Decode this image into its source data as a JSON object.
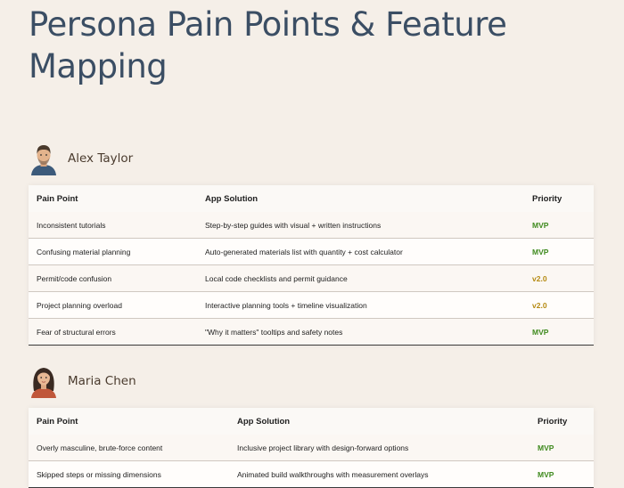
{
  "page": {
    "title": "Persona Pain Points & Feature Mapping"
  },
  "colors": {
    "mvp": "#3f8a1e",
    "v2": "#b58a12"
  },
  "table_headers": {
    "pain_point": "Pain Point",
    "solution": "App Solution",
    "priority": "Priority"
  },
  "personas": [
    {
      "name": "Alex Taylor",
      "avatar_icon": "man-avatar-icon",
      "rows": [
        {
          "pain": "Inconsistent tutorials",
          "solution": "Step-by-step guides with visual + written instructions",
          "priority": "MVP"
        },
        {
          "pain": "Confusing material planning",
          "solution": "Auto-generated materials list with quantity + cost calculator",
          "priority": "MVP"
        },
        {
          "pain": "Permit/code confusion",
          "solution": "Local code checklists and permit guidance",
          "priority": "v2.0"
        },
        {
          "pain": "Project planning overload",
          "solution": "Interactive planning tools + timeline visualization",
          "priority": "v2.0"
        },
        {
          "pain": "Fear of structural errors",
          "solution": "\"Why it matters\" tooltips and safety notes",
          "priority": "MVP"
        }
      ]
    },
    {
      "name": "Maria Chen",
      "avatar_icon": "woman-avatar-icon",
      "rows": [
        {
          "pain": "Overly masculine, brute-force content",
          "solution": "Inclusive project library with design-forward options",
          "priority": "MVP"
        },
        {
          "pain": "Skipped steps or missing dimensions",
          "solution": "Animated build walkthroughs with measurement overlays",
          "priority": "MVP"
        }
      ]
    }
  ]
}
